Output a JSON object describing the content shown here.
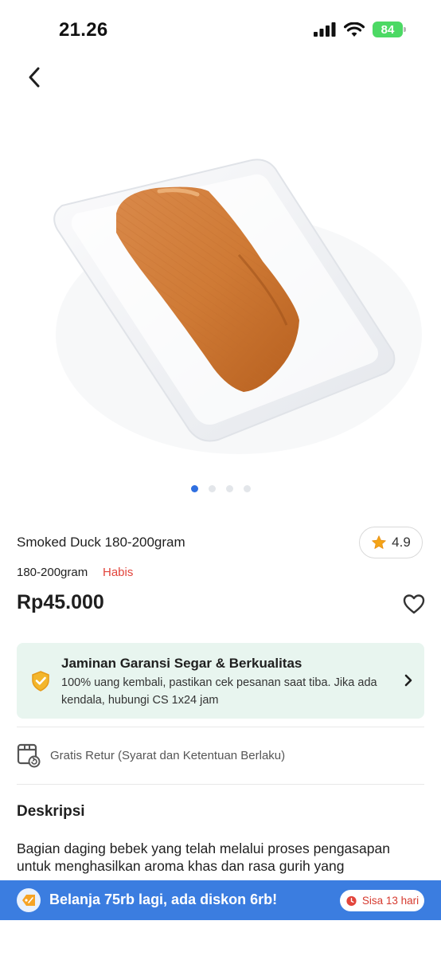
{
  "status": {
    "time": "21.26",
    "battery": "84"
  },
  "carousel": {
    "count": 4,
    "active": 0
  },
  "product": {
    "title": "Smoked Duck 180-200gram",
    "rating": "4.9",
    "variant": "180-200gram",
    "stock": "Habis",
    "price": "Rp45.000"
  },
  "guarantee": {
    "title": "Jaminan Garansi Segar & Berkualitas",
    "description": "100% uang kembali, pastikan cek pesanan saat tiba. Jika ada kendala, hubungi CS 1x24 jam"
  },
  "returns": {
    "text": "Gratis Retur (Syarat dan Ketentuan Berlaku)"
  },
  "description": {
    "title": "Deskripsi",
    "text": "Bagian daging bebek yang telah melalui proses pengasapan untuk menghasilkan aroma khas dan rasa gurih yang"
  },
  "promo": {
    "text": "Belanja 75rb lagi, ada diskon 6rb!",
    "timer": "Sisa 13 hari"
  },
  "colors": {
    "accent": "#3b7de0",
    "danger": "#e2453c",
    "guarantee_bg": "#e8f5ef"
  },
  "icons": [
    "back-icon",
    "star-icon",
    "heart-icon",
    "shield-check-icon",
    "chevron-right-icon",
    "return-box-icon",
    "discount-icon",
    "clock-icon"
  ]
}
